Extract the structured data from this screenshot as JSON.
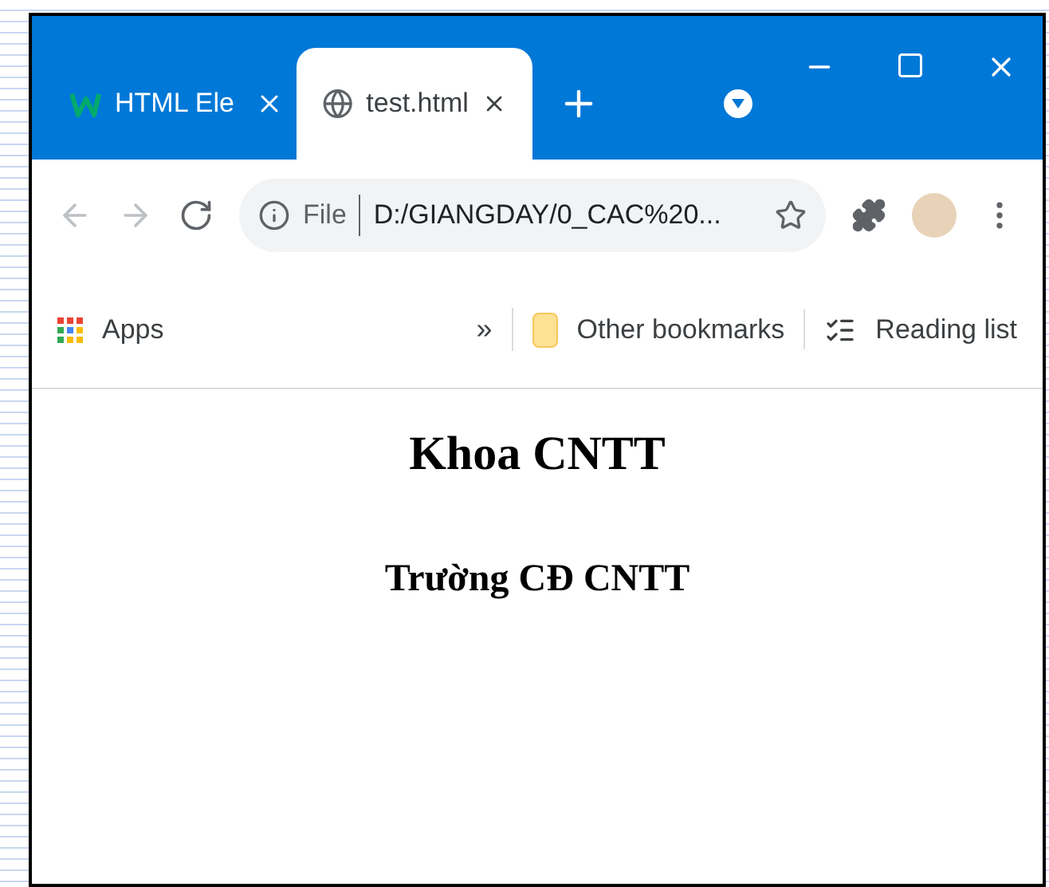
{
  "tabs": [
    {
      "label": "HTML Ele",
      "selected": false,
      "kind": "w3"
    },
    {
      "label": "test.html",
      "selected": true,
      "kind": "globe"
    }
  ],
  "address_bar": {
    "scheme": "File",
    "url": "D:/GIANGDAY/0_CAC%20..."
  },
  "bookmarks_bar": {
    "apps": "Apps",
    "overflow": "»",
    "other": "Other bookmarks",
    "reading_list": "Reading list"
  },
  "page": {
    "heading": "Khoa CNTT",
    "subheading": "Trường CĐ CNTT"
  }
}
